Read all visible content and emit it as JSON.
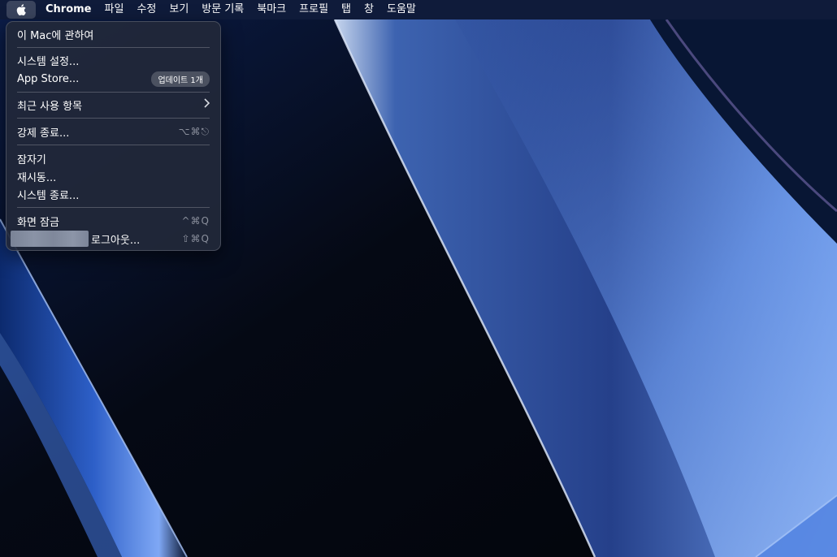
{
  "menubar": {
    "app_name": "Chrome",
    "menus": [
      "파일",
      "수정",
      "보기",
      "방문 기록",
      "북마크",
      "프로필",
      "탭",
      "창",
      "도움말"
    ]
  },
  "apple_menu": {
    "about": "이 Mac에 관하여",
    "system_settings": "시스템 설정...",
    "app_store": "App Store...",
    "app_store_badge": "업데이트 1개",
    "recent_items": "최근 사용 항목",
    "force_quit": "강제 종료...",
    "force_quit_shortcut": "⌥⌘⎋",
    "sleep": "잠자기",
    "restart": "재시동...",
    "shutdown": "시스템 종료...",
    "lock_screen": "화면 잠금",
    "lock_screen_shortcut": "^⌘Q",
    "logout": "로그아웃...",
    "logout_shortcut": "⇧⌘Q"
  },
  "icons": {
    "apple": "apple-logo-icon",
    "submenu": "chevron-right-icon"
  },
  "colors": {
    "menubar_bg": "#0f1b3a",
    "menu_bg": "#22283a",
    "wallpaper_accent": "#5f8fe6"
  }
}
